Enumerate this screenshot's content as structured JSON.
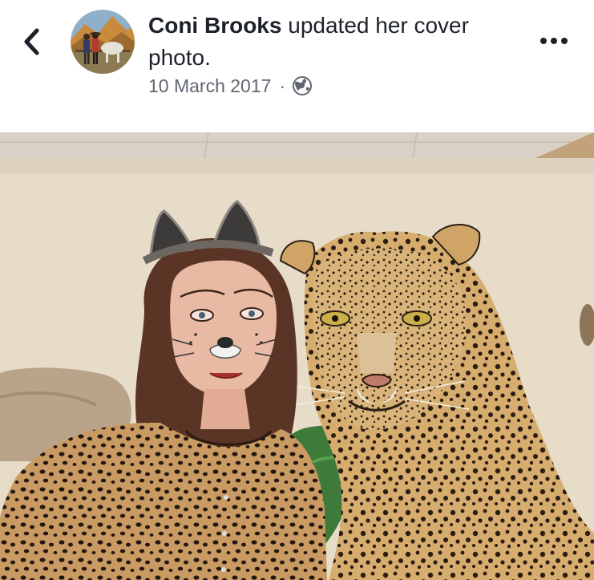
{
  "post": {
    "author_name": "Coni Brooks",
    "action_text": " updated her cover photo.",
    "date": "10 March 2017",
    "separator": "·",
    "privacy_icon": "globe-icon"
  },
  "nav": {
    "back_icon": "chevron-left-icon",
    "more_icon": "more-horizontal-icon"
  },
  "colors": {
    "text_primary": "#1d2129",
    "text_secondary": "#606770",
    "background": "#ffffff"
  }
}
